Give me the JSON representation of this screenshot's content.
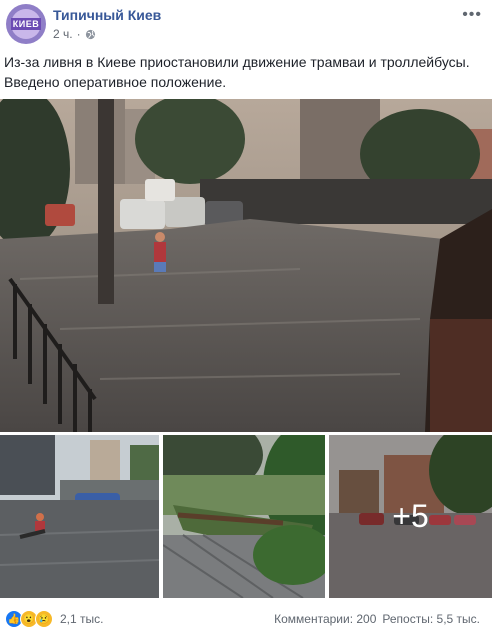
{
  "post": {
    "page_name": "Типичный Киев",
    "time": "2 ч.",
    "separator": "·",
    "avatar_text": "КИЕВ",
    "text": "Из-за ливня в Киеве приостановили движение трамваи и троллейбусы. Введено оперативное положение."
  },
  "photos": {
    "more_count": "+5"
  },
  "footer": {
    "reaction_count": "2,1 тыс.",
    "comments": "Комментарии: 200",
    "shares": "Репосты: 5,5 тыс."
  },
  "icons": {
    "globe": "globe-icon",
    "more": "more-options-icon",
    "like": "like-reaction-icon",
    "wow": "wow-reaction-icon",
    "sad": "sad-reaction-icon"
  },
  "colors": {
    "page_name": "#385898",
    "like": "#1877f2",
    "emoji": "#f7b928"
  }
}
